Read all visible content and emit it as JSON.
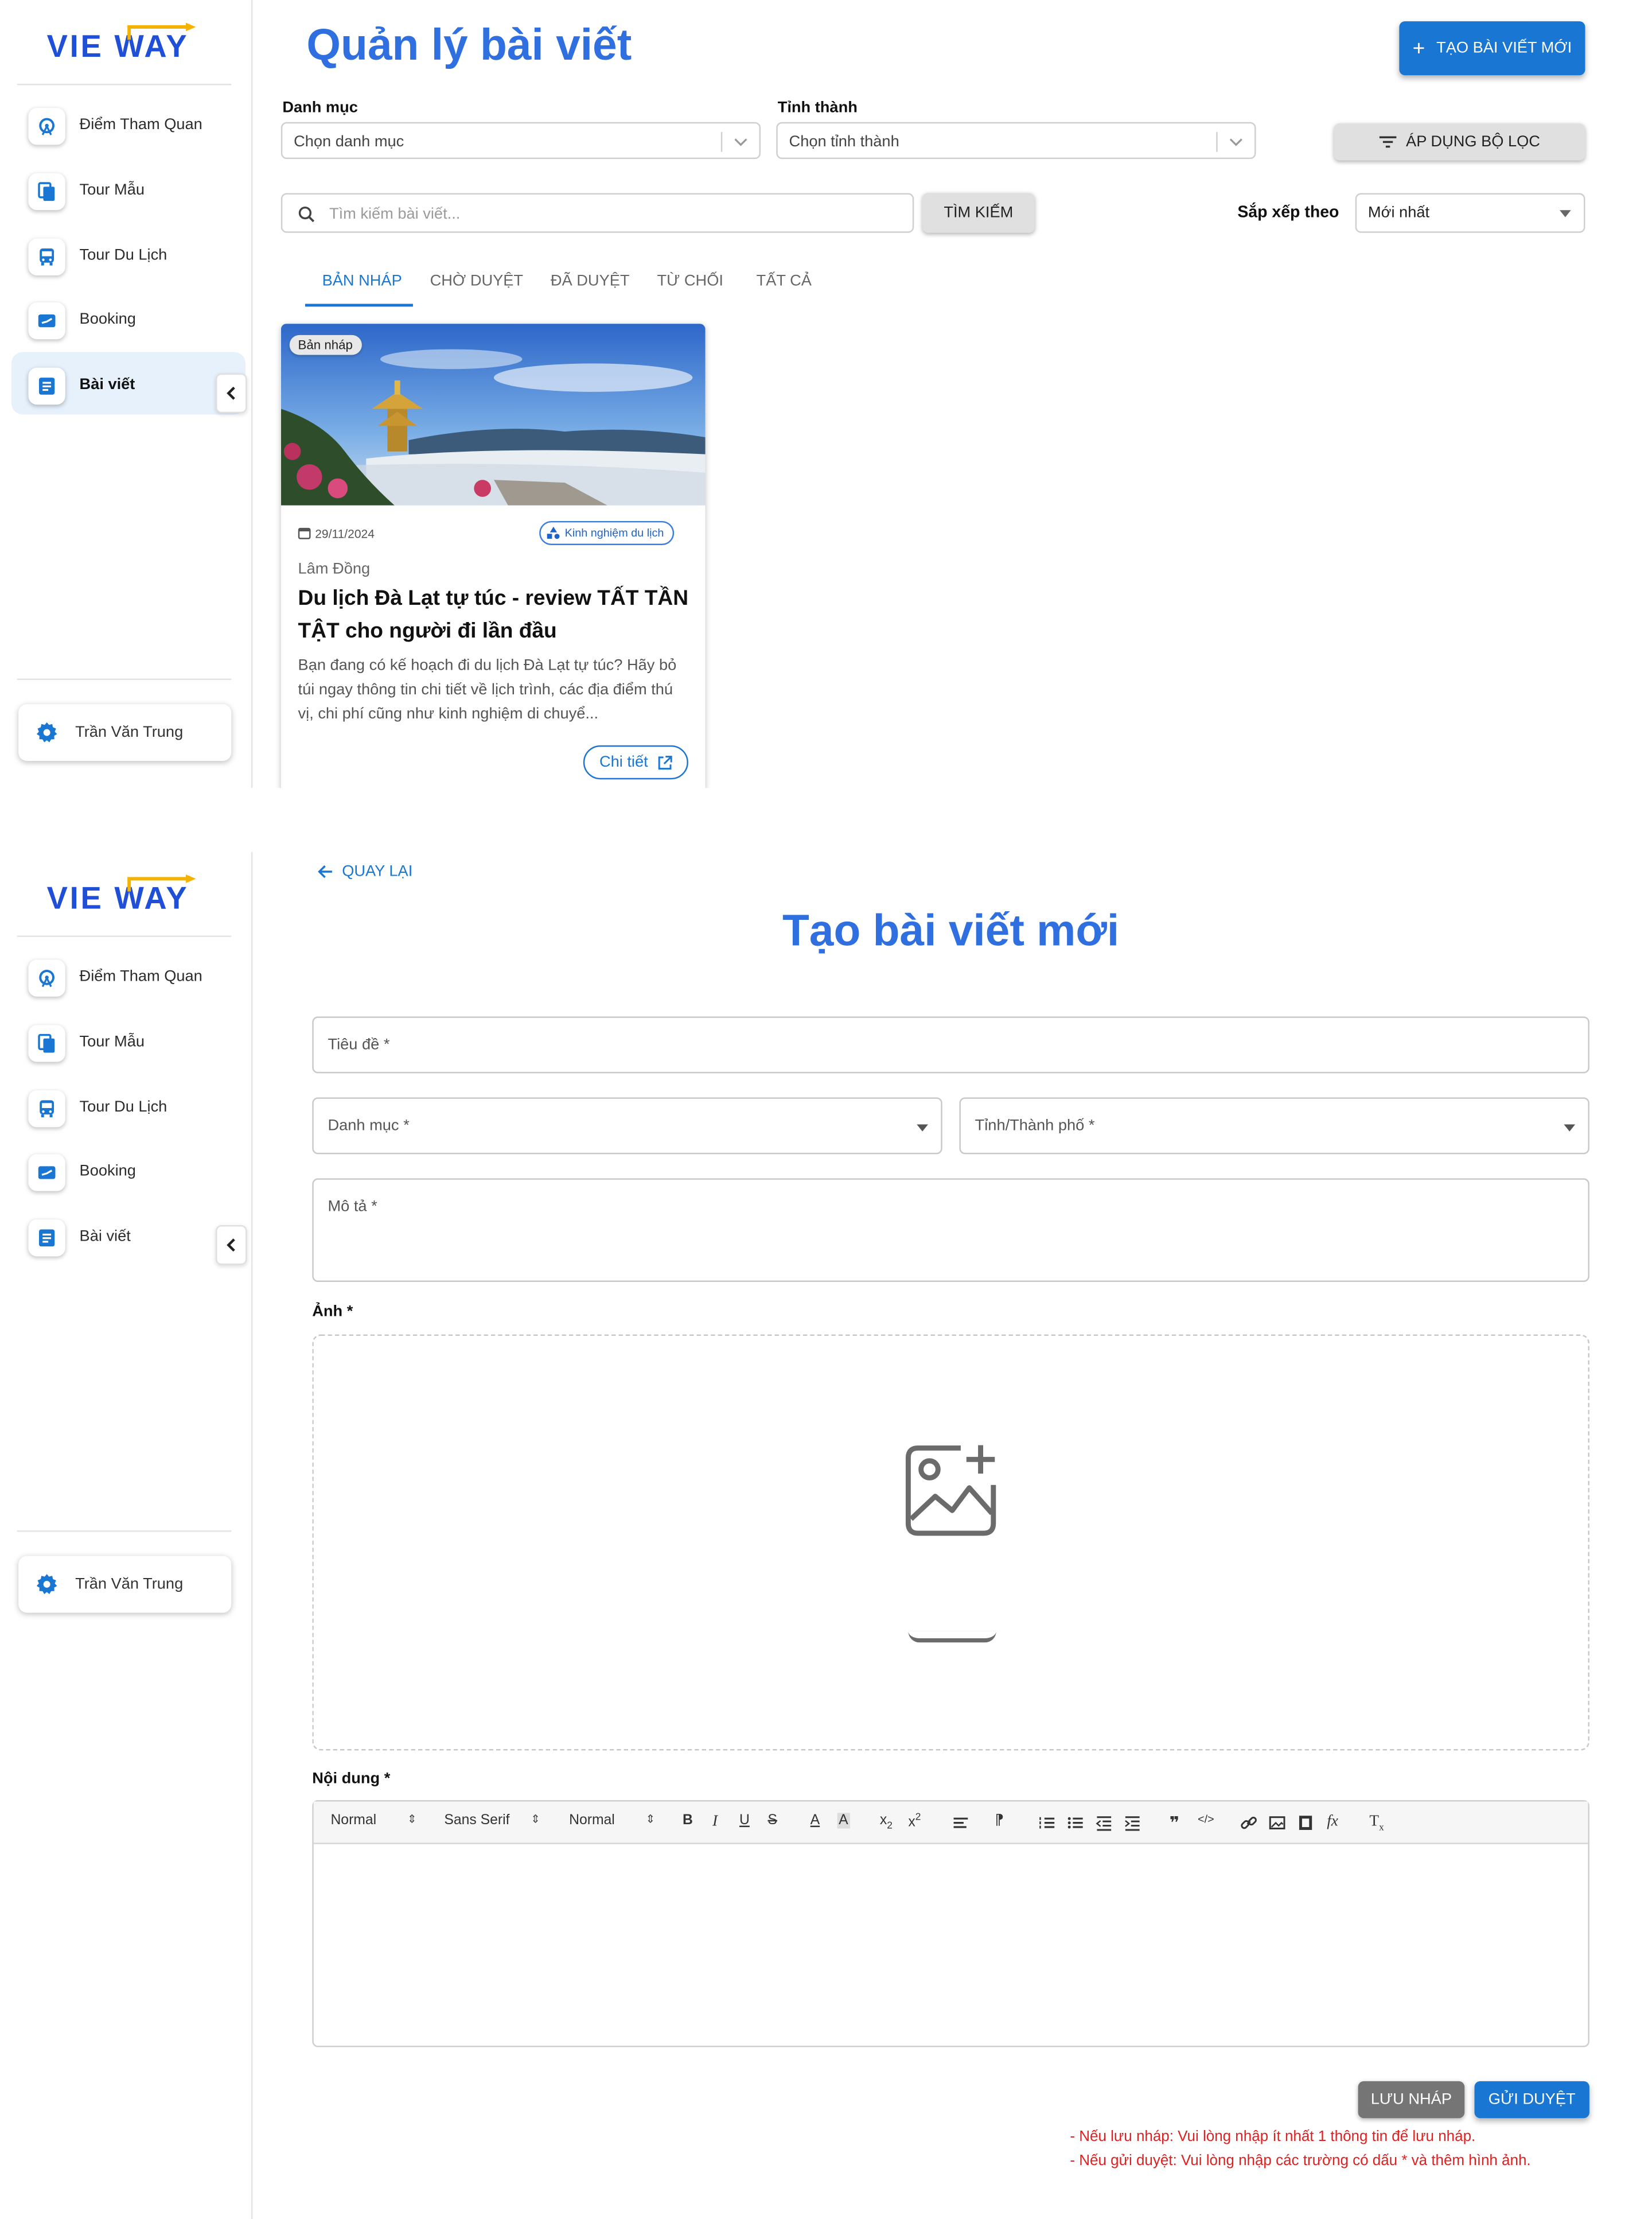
{
  "brand": {
    "logo_text": "VIE  WAY",
    "logo_accent": "#f5b300",
    "logo_color": "#1f4fd6"
  },
  "colors": {
    "primary": "#1976d2",
    "title": "#2f6fe0",
    "error": "#e02020",
    "active_nav_bg": "#e6f1fc"
  },
  "sidebar": {
    "items": [
      {
        "label": "Điểm Tham Quan",
        "icon": "ferris-wheel-icon"
      },
      {
        "label": "Tour Mẫu",
        "icon": "copy-icon"
      },
      {
        "label": "Tour Du Lịch",
        "icon": "bus-icon"
      },
      {
        "label": "Booking",
        "icon": "ticket-icon"
      },
      {
        "label": "Bài viết",
        "icon": "article-icon"
      }
    ],
    "user_name": "Trần Văn Trung"
  },
  "list_page": {
    "title": "Quản lý bài viết",
    "create_button": "TẠO BÀI VIẾT MỚI",
    "filters": {
      "category_label": "Danh mục",
      "category_placeholder": "Chọn danh mục",
      "province_label": "Tỉnh thành",
      "province_placeholder": "Chọn tỉnh thành",
      "apply_button": "ÁP DỤNG BỘ LỌC"
    },
    "search": {
      "placeholder": "Tìm kiếm bài viết...",
      "button": "TÌM KIẾM",
      "sort_label": "Sắp xếp theo",
      "sort_value": "Mới nhất"
    },
    "tabs": [
      {
        "label": "BẢN NHÁP",
        "active": true
      },
      {
        "label": "CHỜ DUYỆT",
        "active": false
      },
      {
        "label": "ĐÃ DUYỆT",
        "active": false
      },
      {
        "label": "TỪ CHỐI",
        "active": false
      },
      {
        "label": "TẤT CẢ",
        "active": false
      }
    ],
    "posts": [
      {
        "status_badge": "Bản nháp",
        "date": "29/11/2024",
        "category": "Kinh nghiệm du lịch",
        "location": "Lâm Đồng",
        "title": "Du lịch Đà Lạt tự túc - review TẤT TẦN TẬT cho người đi lần đầu",
        "description": "Bạn đang có kế hoạch đi du lịch Đà Lạt tự túc? Hãy bỏ túi ngay thông tin chi tiết về lịch trình, các địa điểm thú vị, chi phí cũng như kinh nghiệm di chuyể...",
        "detail_button": "Chi tiết"
      }
    ]
  },
  "create_page": {
    "back_button": "QUAY LẠI",
    "title": "Tạo bài viết mới",
    "fields": {
      "title_placeholder": "Tiêu đề *",
      "category_placeholder": "Danh mục *",
      "province_placeholder": "Tỉnh/Thành phố *",
      "description_placeholder": "Mô tả *"
    },
    "image_label": "Ảnh *",
    "content_label": "Nội dung *",
    "editor_toolbar": {
      "header_select": "Normal",
      "font_select": "Sans Serif",
      "size_select": "Normal"
    },
    "save_draft_button": "LƯU NHÁP",
    "submit_button": "GỬI DUYỆT",
    "notes": [
      "- Nếu lưu nháp: Vui lòng nhập ít nhất 1 thông tin để lưu nháp.",
      "- Nếu gửi duyệt: Vui lòng nhập các trường có dấu * và thêm hình ảnh."
    ]
  }
}
